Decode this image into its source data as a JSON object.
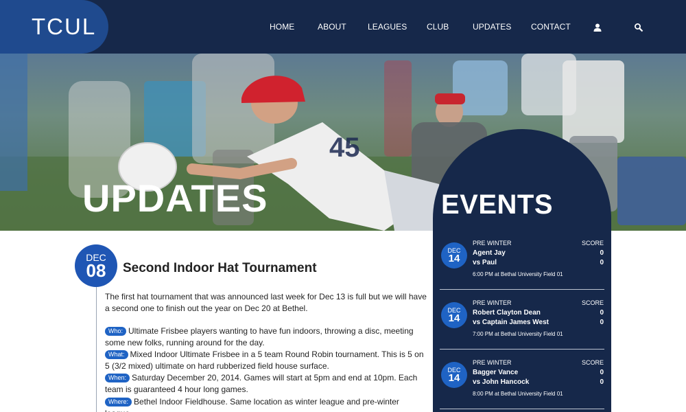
{
  "header": {
    "logo_text": "TCUL",
    "nav": [
      "HOME",
      "ABOUT",
      "LEAGUES",
      "CLUB",
      "UPDATES",
      "CONTACT"
    ],
    "icons": [
      "user-icon",
      "search-icon"
    ]
  },
  "hero": {
    "title": "UPDATES"
  },
  "article": {
    "date_month": "DEC",
    "date_day": "08",
    "title": "Second Indoor Hat Tournament",
    "intro": "The first hat tournament that was announced last week for Dec 13 is full but we will have a second one to finish out the year on Dec 20 at Bethel.",
    "details": [
      {
        "tag": "Who:",
        "text": "Ultimate Frisbee players wanting to have fun indoors, throwing a disc, meeting some new folks, running around for the day."
      },
      {
        "tag": "What:",
        "text": "Mixed Indoor Ultimate Frisbee in a 5 team Round Robin tournament. This is 5 on 5 (3/2 mixed) ultimate on hard rubberized field house surface."
      },
      {
        "tag": "When:",
        "text": "Saturday December 20, 2014. Games will start at 5pm and end at 10pm. Each team is guaranteed 4 hour long games."
      },
      {
        "tag": "Where:",
        "text": "Bethel Indoor Fieldhouse. Same location as winter league and pre-winter league."
      }
    ]
  },
  "events": {
    "title": "EVENTS",
    "items": [
      {
        "month": "DEC",
        "day": "14",
        "league": "PRE WINTER",
        "score_label": "SCORE",
        "team1": "Agent Jay",
        "score1": "0",
        "team2": "vs Paul",
        "score2": "0",
        "time": "6:00 PM at Bethal University Field 01"
      },
      {
        "month": "DEC",
        "day": "14",
        "league": "PRE WINTER",
        "score_label": "SCORE",
        "team1": "Robert Clayton Dean",
        "score1": "0",
        "team2": "vs Captain James West",
        "score2": "0",
        "time": "7:00 PM at Bethal University Field 01"
      },
      {
        "month": "DEC",
        "day": "14",
        "league": "PRE WINTER",
        "score_label": "SCORE",
        "team1": "Bagger Vance",
        "score1": "0",
        "team2": "vs John Hancock",
        "score2": "0",
        "time": "8:00 PM at Bethal University Field 01"
      }
    ]
  },
  "colors": {
    "header_bg": "#16284a",
    "logo_bg": "#1f4a8e",
    "accent_blue": "#1f63c4",
    "events_bg": "#16284a"
  }
}
